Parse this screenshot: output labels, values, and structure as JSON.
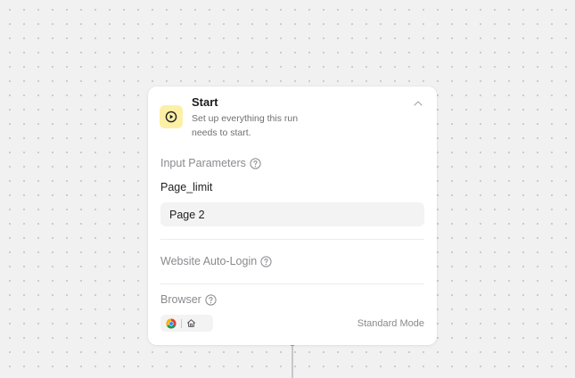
{
  "node": {
    "title": "Start",
    "description": "Set up everything this run needs to start.",
    "icon": "play-circle-icon",
    "icon_bg": "#fdf0a6"
  },
  "input_parameters": {
    "label": "Input Parameters",
    "params": [
      {
        "name": "Page_limit",
        "value": "Page 2"
      }
    ]
  },
  "auto_login": {
    "label": "Website Auto-Login"
  },
  "browser": {
    "label": "Browser",
    "options": [
      "chrome-icon",
      "home-icon"
    ],
    "mode": "Standard Mode"
  },
  "colors": {
    "connector_active": "#2ecc8a",
    "canvas_bg": "#f1f1f2"
  }
}
